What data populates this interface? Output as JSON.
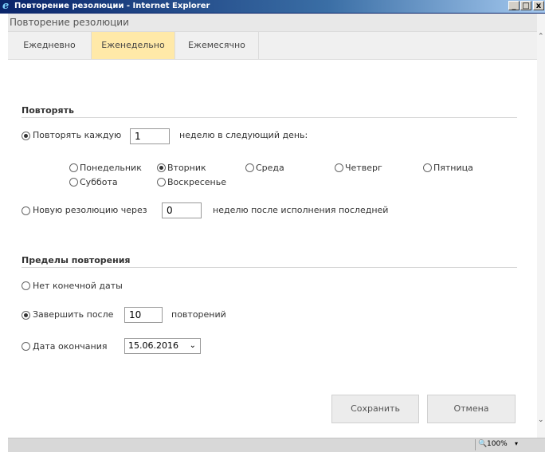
{
  "window": {
    "title": "Повторение резолюции - Internet Explorer",
    "minimize": "_",
    "maximize": "□",
    "close": "x"
  },
  "header": {
    "title": "Повторение резолюции"
  },
  "tabs": [
    {
      "label": "Ежедневно",
      "active": false
    },
    {
      "label": "Еженедельно",
      "active": true
    },
    {
      "label": "Ежемесячно",
      "active": false
    }
  ],
  "repeat": {
    "section_title": "Повторять",
    "every_label": "Повторять каждую",
    "every_value": "1",
    "every_suffix": "неделю в следующий день:",
    "days": [
      {
        "label": "Понедельник",
        "selected": false
      },
      {
        "label": "Вторник",
        "selected": true
      },
      {
        "label": "Среда",
        "selected": false
      },
      {
        "label": "Четверг",
        "selected": false
      },
      {
        "label": "Пятница",
        "selected": false
      },
      {
        "label": "Суббота",
        "selected": false
      },
      {
        "label": "Воскресенье",
        "selected": false
      }
    ],
    "after_label": "Новую резолюцию через",
    "after_value": "0",
    "after_suffix": "неделю после исполнения последней"
  },
  "limits": {
    "section_title": "Пределы повторения",
    "no_end_label": "Нет конечной даты",
    "end_after_label": "Завершить после",
    "end_after_value": "10",
    "end_after_suffix": "повторений",
    "end_date_label": "Дата окончания",
    "end_date_value": "15.06.2016"
  },
  "buttons": {
    "save": "Сохранить",
    "cancel": "Отмена"
  },
  "status": {
    "zoom": "100%"
  }
}
